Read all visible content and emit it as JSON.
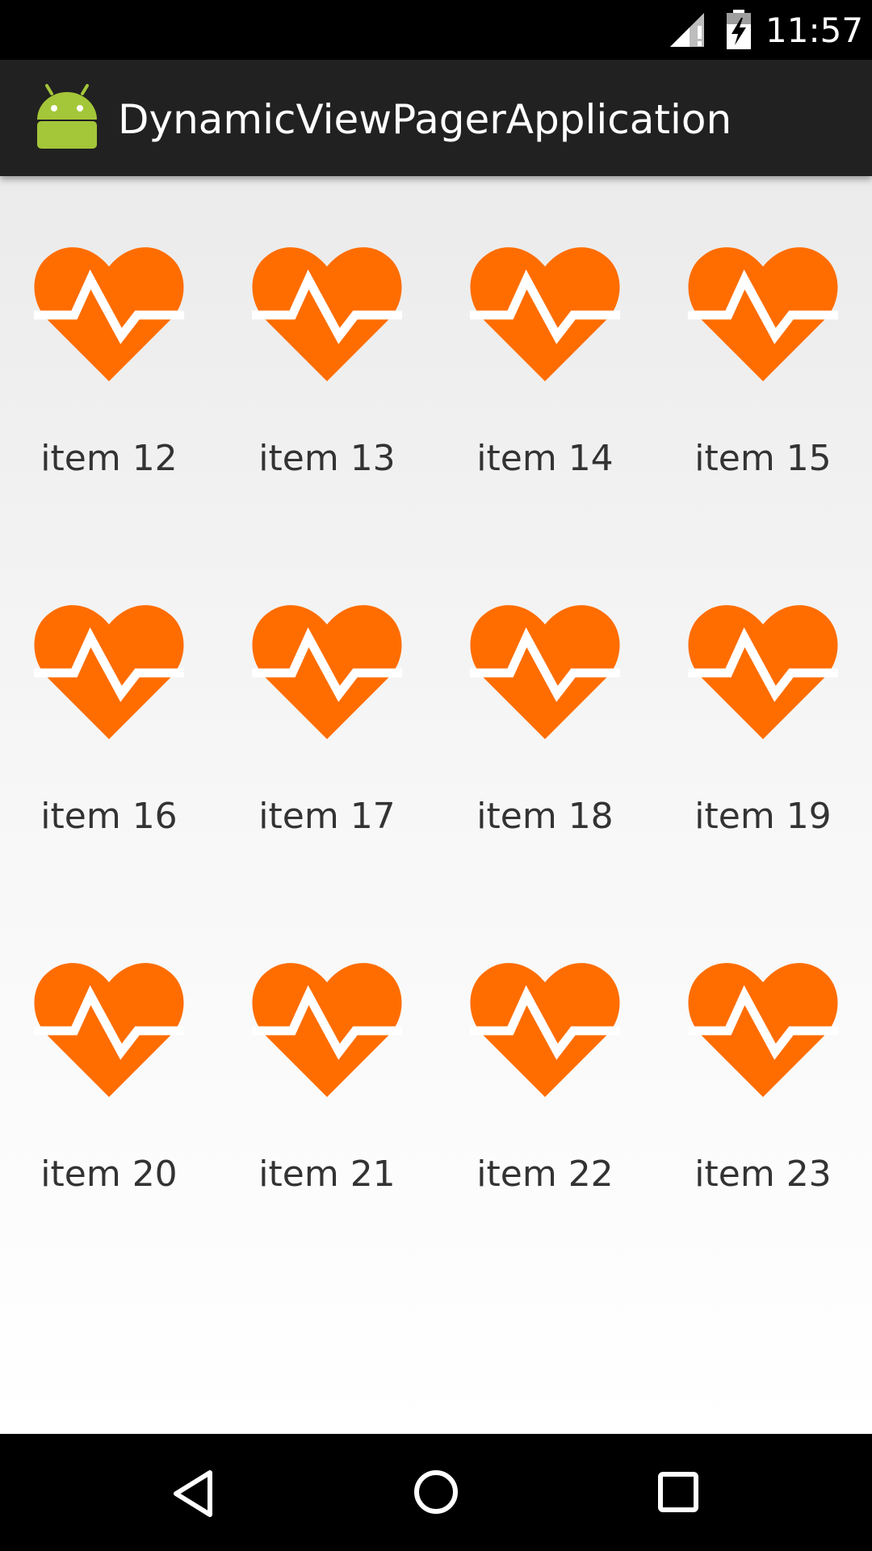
{
  "status_bar": {
    "time": "11:57",
    "icons": [
      "cellular-signal-alert-icon",
      "battery-charging-icon"
    ]
  },
  "action_bar": {
    "icon": "android-robot-icon",
    "title": "DynamicViewPagerApplication"
  },
  "grid": {
    "icon": "heart-pulse-icon",
    "accent_color": "#ff6d00",
    "rows": [
      [
        {
          "label": "item 12"
        },
        {
          "label": "item 13"
        },
        {
          "label": "item 14"
        },
        {
          "label": "item 15"
        }
      ],
      [
        {
          "label": "item 16"
        },
        {
          "label": "item 17"
        },
        {
          "label": "item 18"
        },
        {
          "label": "item 19"
        }
      ],
      [
        {
          "label": "item 20"
        },
        {
          "label": "item 21"
        },
        {
          "label": "item 22"
        },
        {
          "label": "item 23"
        }
      ]
    ]
  },
  "nav_bar": {
    "buttons": [
      "back-icon",
      "home-icon",
      "recents-icon"
    ]
  }
}
